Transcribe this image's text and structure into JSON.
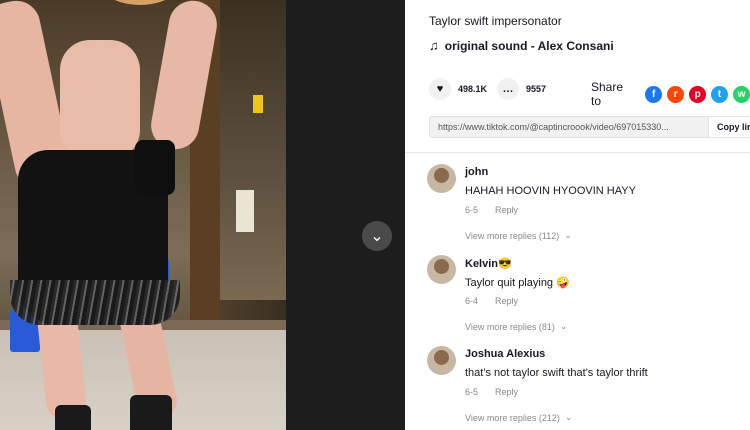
{
  "video": {
    "nav_down_icon": "chevron-down-icon"
  },
  "post": {
    "description": "Taylor swift impersonator",
    "sound": "original sound - Alex Consani",
    "likes": "498.1K",
    "comments_count": "9557",
    "share_label": "Share to",
    "share_targets": [
      {
        "name": "facebook",
        "glyph": "f",
        "color": "#1877f2"
      },
      {
        "name": "reddit",
        "glyph": "r",
        "color": "#ff4500"
      },
      {
        "name": "pinterest",
        "glyph": "p",
        "color": "#e60023"
      },
      {
        "name": "twitter",
        "glyph": "t",
        "color": "#1da1f2"
      },
      {
        "name": "whatsapp",
        "glyph": "w",
        "color": "#25d366"
      }
    ],
    "link_url": "https://www.tiktok.com/@captincroook/video/697015330...",
    "copy_label": "Copy lir"
  },
  "comments": [
    {
      "name": "john",
      "text": "HAHAH HOOVIN HYOOVIN HAYY",
      "date": "6-5",
      "reply": "Reply",
      "more": "View more replies (112)"
    },
    {
      "name": "Kelvin😎",
      "text": "Taylor quit playing 🤪",
      "date": "6-4",
      "reply": "Reply",
      "more": "View more replies (81)"
    },
    {
      "name": "Joshua Alexius",
      "text": "that's not taylor swift that's taylor thrift",
      "date": "6-5",
      "reply": "Reply",
      "more": "View more replies (212)"
    }
  ]
}
